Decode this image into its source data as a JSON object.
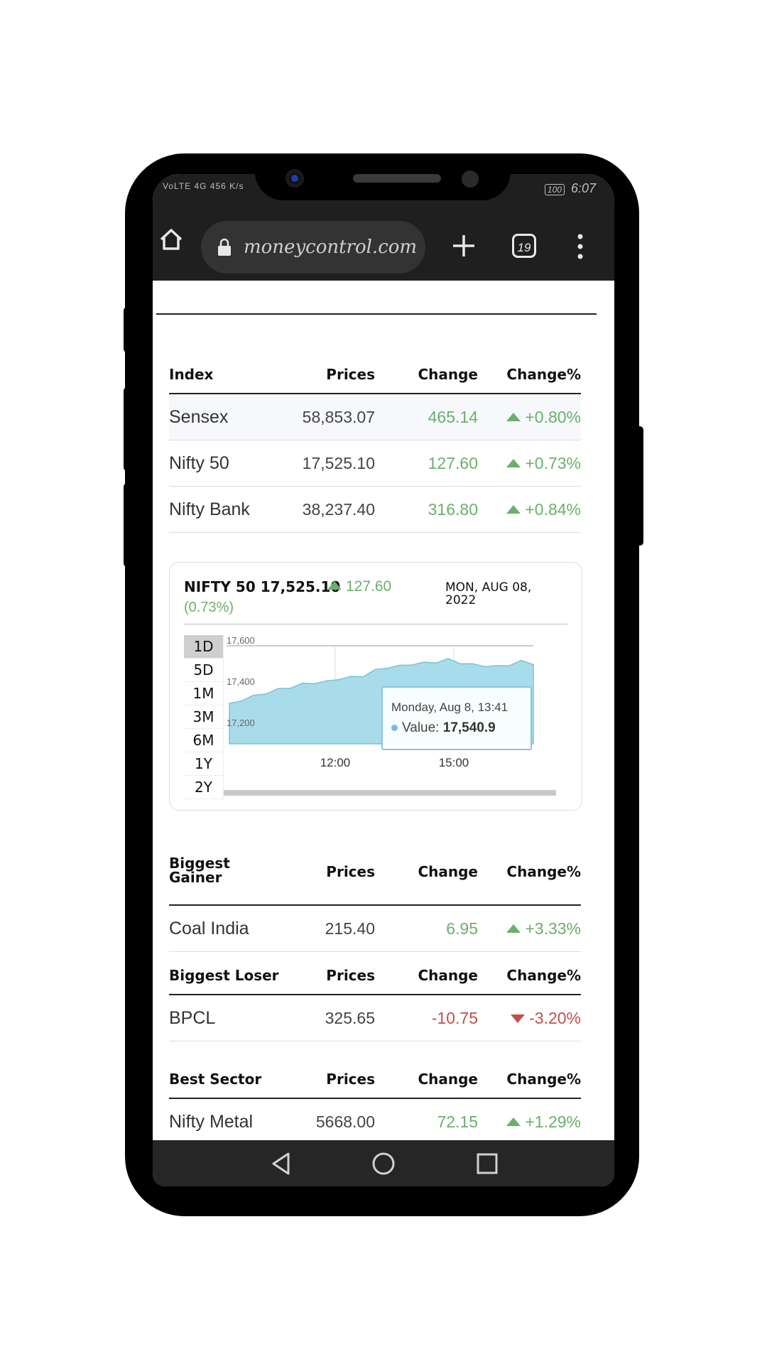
{
  "status_bar": {
    "left": "VoLTE 4G 456 K/s",
    "battery": "100",
    "time": "6:07"
  },
  "browser": {
    "url": "moneycontrol.com",
    "tab_count": "19"
  },
  "indices": {
    "headers": [
      "Index",
      "Prices",
      "Change",
      "Change%"
    ],
    "rows": [
      {
        "name": "Sensex",
        "price": "58,853.07",
        "change": "465.14",
        "change_pct": "+0.80%"
      },
      {
        "name": "Nifty 50",
        "price": "17,525.10",
        "change": "127.60",
        "change_pct": "+0.73%"
      },
      {
        "name": "Nifty Bank",
        "price": "38,237.40",
        "change": "316.80",
        "change_pct": "+0.84%"
      }
    ]
  },
  "chart_card": {
    "title": "NIFTY 50",
    "price": "17,525.10",
    "change": "127.60",
    "change_pct": "(0.73%)",
    "date": "MON, AUG 08, 2022",
    "periods": [
      "1D",
      "5D",
      "1M",
      "3M",
      "6M",
      "1Y",
      "2Y"
    ],
    "active_period": "1D",
    "tooltip": {
      "date": "Monday, Aug 8, 13:41",
      "label": "Value:",
      "value": "17,540.9"
    }
  },
  "chart_data": {
    "type": "area",
    "x": [
      "09:15",
      "09:30",
      "09:45",
      "10:00",
      "10:15",
      "10:30",
      "10:45",
      "11:00",
      "11:15",
      "11:30",
      "11:45",
      "12:00",
      "12:15",
      "12:30",
      "12:45",
      "13:00",
      "13:15",
      "13:30",
      "13:41",
      "13:55",
      "14:10",
      "14:25",
      "14:40",
      "14:55",
      "15:10",
      "15:30"
    ],
    "values": [
      17365,
      17380,
      17395,
      17410,
      17420,
      17430,
      17440,
      17450,
      17455,
      17465,
      17470,
      17480,
      17500,
      17510,
      17515,
      17525,
      17530,
      17535,
      17541,
      17530,
      17525,
      17520,
      17515,
      17525,
      17535,
      17525
    ],
    "yticks": [
      "17,600",
      "17,400",
      "17,200"
    ],
    "xticks": [
      "12:00",
      "15:00"
    ],
    "ylim": [
      17200,
      17600
    ],
    "color": "#a9dcea",
    "line_color": "#7cc0d9"
  },
  "gainer": {
    "headers": [
      "Biggest Gainer",
      "Prices",
      "Change",
      "Change%"
    ],
    "row": {
      "name": "Coal India",
      "price": "215.40",
      "change": "6.95",
      "change_pct": "+3.33%"
    }
  },
  "loser": {
    "headers": [
      "Biggest Loser",
      "Prices",
      "Change",
      "Change%"
    ],
    "row": {
      "name": "BPCL",
      "price": "325.65",
      "change": "-10.75",
      "change_pct": "-3.20%"
    }
  },
  "sector": {
    "headers": [
      "Best Sector",
      "Prices",
      "Change",
      "Change%"
    ],
    "row": {
      "name": "Nifty Metal",
      "price": "5668.00",
      "change": "72.15",
      "change_pct": "+1.29%"
    }
  },
  "colors": {
    "up": "#6ab06c",
    "down": "#c0504d"
  }
}
